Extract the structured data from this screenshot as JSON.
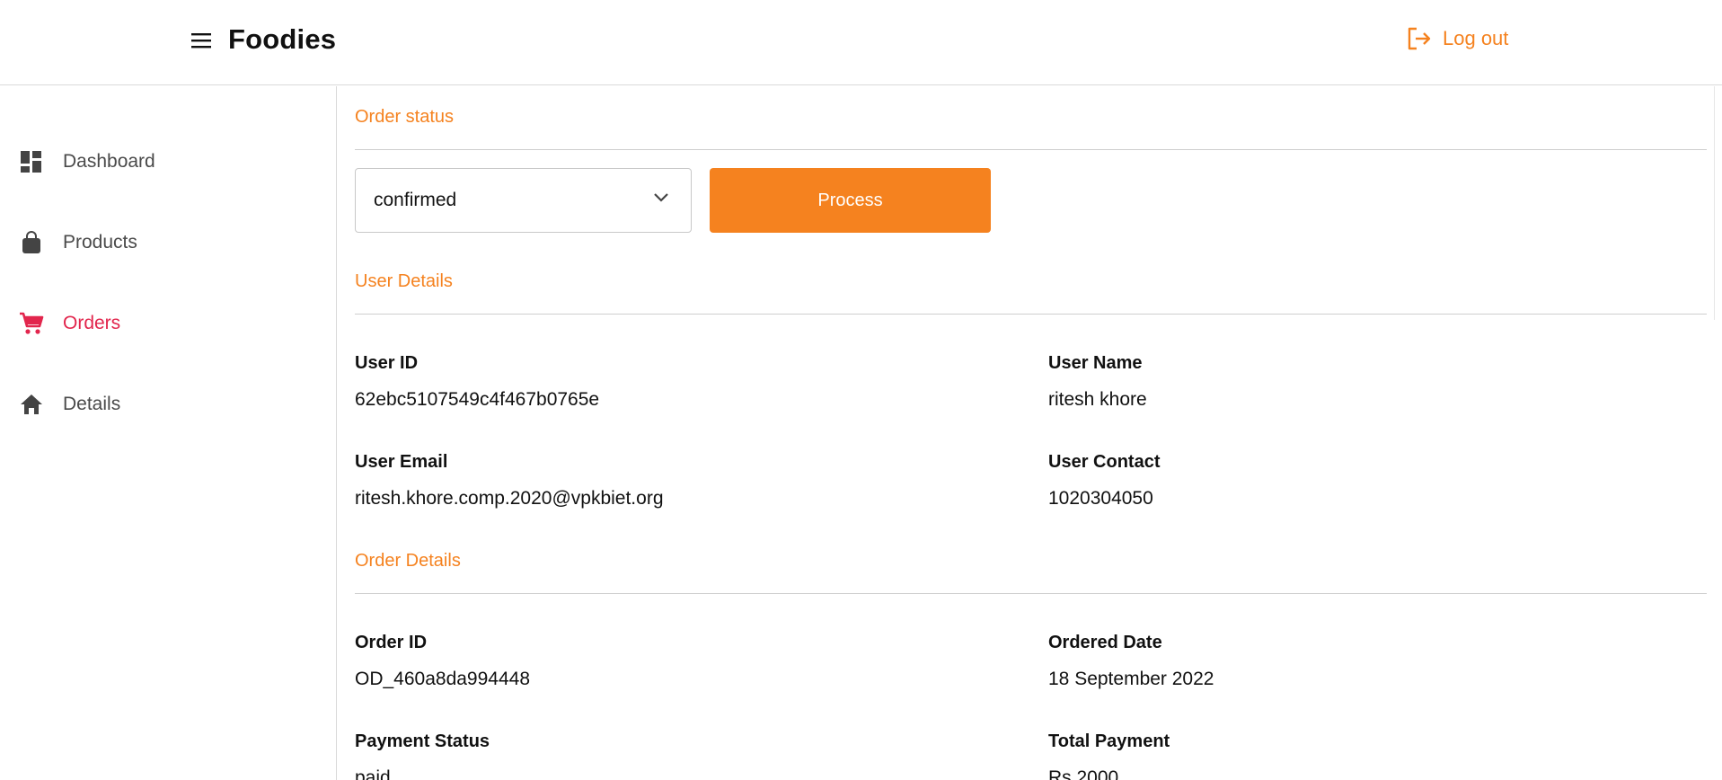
{
  "header": {
    "brand": "Foodies",
    "logout_label": "Log out",
    "accent_color": "#f5821f"
  },
  "sidebar": {
    "items": [
      {
        "label": "Dashboard",
        "icon": "dashboard-icon"
      },
      {
        "label": "Products",
        "icon": "shopping-bag-icon"
      },
      {
        "label": "Orders",
        "icon": "cart-icon",
        "active": true
      },
      {
        "label": "Details",
        "icon": "home-icon"
      }
    ],
    "active_color": "#e2264d"
  },
  "order_status": {
    "title": "Order status",
    "selected": "confirmed",
    "process_label": "Process"
  },
  "user_details": {
    "title": "User Details",
    "user_id_label": "User ID",
    "user_id": "62ebc5107549c4f467b0765e",
    "user_name_label": "User Name",
    "user_name": "ritesh khore",
    "user_email_label": "User Email",
    "user_email": "ritesh.khore.comp.2020@vpkbiet.org",
    "user_contact_label": "User Contact",
    "user_contact": "1020304050"
  },
  "order_details": {
    "title": "Order Details",
    "order_id_label": "Order ID",
    "order_id": "OD_460a8da994448",
    "ordered_date_label": "Ordered Date",
    "ordered_date": "18 September 2022",
    "payment_status_label": "Payment Status",
    "payment_status": "paid",
    "total_payment_label": "Total Payment",
    "total_payment": "Rs 2000"
  }
}
